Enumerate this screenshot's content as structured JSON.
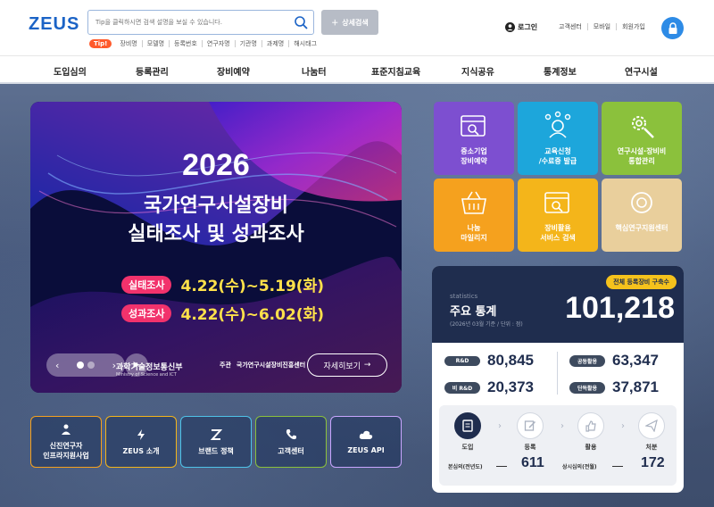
{
  "header": {
    "logo": "ZEUS",
    "search_placeholder": "Tip을 클릭하시면 검색 설명을 보실 수 있습니다.",
    "advanced_search": "상세검색",
    "tip_badge": "Tip!",
    "tip_keywords": [
      "장비명",
      "모델명",
      "등록번호",
      "연구자명",
      "기관명",
      "과제명",
      "해시태그"
    ],
    "login": "로그인",
    "utility_links": [
      "고객센터",
      "모바일",
      "회원가입"
    ]
  },
  "nav": {
    "items": [
      "도입심의",
      "등록관리",
      "장비예약",
      "나눔터",
      "표준지침교육",
      "지식공유",
      "통계정보",
      "연구시설"
    ]
  },
  "banner": {
    "year": "2026",
    "title_line1": "국가연구시설장비",
    "title_line2": "실태조사 및 성과조사",
    "rows": [
      {
        "label": "실태조사",
        "date": "4.22(수)~5.19(화)"
      },
      {
        "label": "성과조사",
        "date": "4.22(수)~6.02(화)"
      }
    ],
    "ministry": "과학기술정보통신부",
    "ministry_en": "Ministry of Science and ICT",
    "host_label": "주관",
    "org": "국가연구시설장비진흥센터",
    "more": "자세히보기",
    "controls": {
      "prev": "‹",
      "next": "›",
      "play": "▶"
    }
  },
  "tiles": [
    {
      "label": "중소기업\n장비예약",
      "color": "#7d4fd0",
      "icon": "calendar-search-icon"
    },
    {
      "label": "교육신청\n/수료증 발급",
      "color": "#1da6db",
      "icon": "network-people-icon"
    },
    {
      "label": "연구시설·장비비\n통합관리",
      "color": "#8bc13c",
      "icon": "gear-wrench-icon"
    },
    {
      "label": "나눔\n마일리지",
      "color": "#f5a11e",
      "icon": "basket-icon"
    },
    {
      "label": "장비활용\n서비스 검색",
      "color": "#f4b51a",
      "icon": "calendar-search-icon"
    },
    {
      "label": "핵심연구지원센터",
      "color": "#e9cf9c",
      "icon": "core-center-icon"
    }
  ],
  "stats": {
    "pill": "전체 등록장비 구축수",
    "eng": "statistics",
    "title": "주요 통계",
    "sub": "(2026년 03월 기준 / 단위 : 점)",
    "total": "101,218",
    "items": [
      {
        "label": "R&D",
        "value": "80,845"
      },
      {
        "label": "공동활용",
        "value": "63,347"
      },
      {
        "label": "비 R&D",
        "value": "20,373"
      },
      {
        "label": "단독활용",
        "value": "37,871"
      }
    ],
    "process": [
      "도입",
      "등록",
      "활용",
      "처분"
    ],
    "bottom": [
      {
        "label": "본심의(전년도)",
        "value": "611"
      },
      {
        "label": "상시심의(전월)",
        "value": "172"
      }
    ]
  },
  "quick": [
    {
      "label": "신진연구자\n인프라지원사업",
      "border": "#f5a11e"
    },
    {
      "label": "ZEUS 소개",
      "border": "#f4b51a"
    },
    {
      "label": "브랜드 정책",
      "border": "#4fc3e8"
    },
    {
      "label": "고객센터",
      "border": "#8bc13c"
    },
    {
      "label": "ZEUS API",
      "border": "#c9a6ff"
    }
  ]
}
